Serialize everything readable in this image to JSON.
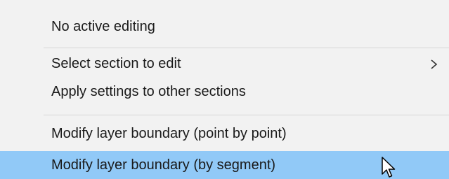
{
  "menu": {
    "items": [
      {
        "label": "No active editing"
      },
      {
        "label": "Select section to edit",
        "has_submenu": true
      },
      {
        "label": "Apply settings to other sections"
      },
      {
        "label": "Modify layer boundary (point by point)"
      },
      {
        "label": "Modify layer boundary (by segment)",
        "highlighted": true
      }
    ],
    "submenu_icon": "chevron-right-icon",
    "cursor_icon": "mouse-pointer-icon"
  },
  "colors": {
    "menu_background": "#f2f2f2",
    "highlight": "#91c9f7",
    "separator": "#d7d7d7",
    "text": "#1a1a1a"
  }
}
